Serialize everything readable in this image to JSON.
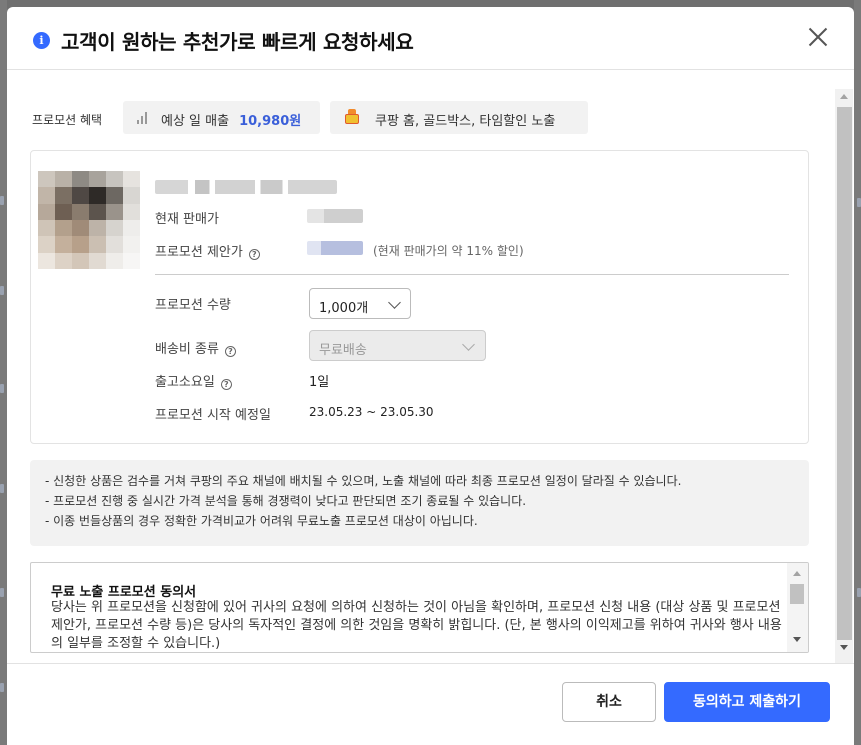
{
  "modal": {
    "title": "고객이 원하는 추천가로 빠르게 요청하세요"
  },
  "benefits": {
    "label": "프로모션 혜택",
    "sales_label": "예상 일 매출",
    "sales_value": "10,980원",
    "exposure_text": "쿠팡 홈, 골드박스, 타임할인 노출"
  },
  "product": {
    "current_price_label": "현재 판매가",
    "proposed_price_label": "프로모션 제안가",
    "discount_note": "(현재 판매가의 약 11% 할인)",
    "quantity_label": "프로모션 수량",
    "quantity_value": "1,000개",
    "shipping_label": "배송비 종류",
    "shipping_value": "무료배송",
    "leadtime_label": "출고소요일",
    "leadtime_value": "1일",
    "start_label": "프로모션 시작 예정일",
    "start_value": "23.05.23 ~ 23.05.30"
  },
  "notices": [
    "- 신청한 상품은 검수를 거쳐 쿠팡의 주요 채널에 배치될 수 있으며, 노출 채널에 따라 최종 프로모션 일정이 달라질 수 있습니다.",
    "- 프로모션 진행 중 실시간 가격 분석을 통해 경쟁력이 낮다고 판단되면 조기 종료될 수 있습니다.",
    "- 이종 번들상품의 경우 정확한 가격비교가 어려워 무료노출 프로모션 대상이 아닙니다."
  ],
  "consent": {
    "title": "무료 노출 프로모션 동의서",
    "body": "당사는 위 프로모션을 신청함에 있어 귀사의 요청에 의하여 신청하는 것이 아님을 확인하며, 프로모션 신청 내용 (대상 상품 및 프로모션 제안가, 프로모션 수량 등)은 당사의 독자적인 결정에 의한 것임을 명확히 밝힙니다. (단, 본 행사의 이익제고를 위하여 귀사와 행사 내용의 일부를 조정할 수 있습니다.)"
  },
  "footer": {
    "cancel_label": "취소",
    "submit_label": "동의하고 제출하기"
  },
  "icons": [
    "info-icon",
    "close-icon",
    "chart-icon",
    "medal-icon",
    "help-icon",
    "chevron-down-icon"
  ],
  "colors": {
    "accent": "#346aff",
    "sales_value": "#3a5fd9"
  }
}
